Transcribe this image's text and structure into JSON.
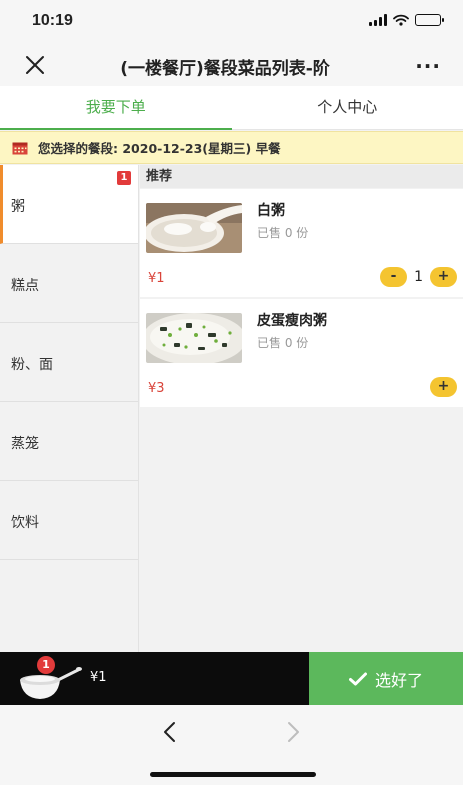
{
  "status_bar": {
    "time": "10:19"
  },
  "nav": {
    "title": "(一楼餐厅)餐段菜品列表-阶",
    "close_icon": "close-icon",
    "more_label": "···"
  },
  "tabs": [
    {
      "label": "我要下单",
      "active": true
    },
    {
      "label": "个人中心",
      "active": false
    }
  ],
  "notice": {
    "text": "您选择的餐段: 2020-12-23(星期三) 早餐"
  },
  "categories": [
    {
      "label": "粥",
      "badge": "1",
      "active": true
    },
    {
      "label": "糕点"
    },
    {
      "label": "粉、面"
    },
    {
      "label": "蒸笼"
    },
    {
      "label": "饮料"
    }
  ],
  "section": {
    "title": "推荐"
  },
  "dishes": [
    {
      "name": "白粥",
      "sold": "已售 0 份",
      "price": "¥1",
      "quantity": "1",
      "minus_label": "-",
      "plus_label": "+"
    },
    {
      "name": "皮蛋瘦肉粥",
      "sold": "已售 0 份",
      "price": "¥3",
      "plus_label": "+"
    }
  ],
  "cart": {
    "count": "1",
    "total": "¥1",
    "confirm_label": "选好了"
  },
  "colors": {
    "accent_green": "#5cb85c",
    "tab_active": "#4cae4c",
    "price_red": "#d9443a",
    "button_yellow": "#f4c430",
    "badge_red": "#e23b3b",
    "active_category_bar": "#f08c2c",
    "notice_bg": "#fdf6c3"
  }
}
